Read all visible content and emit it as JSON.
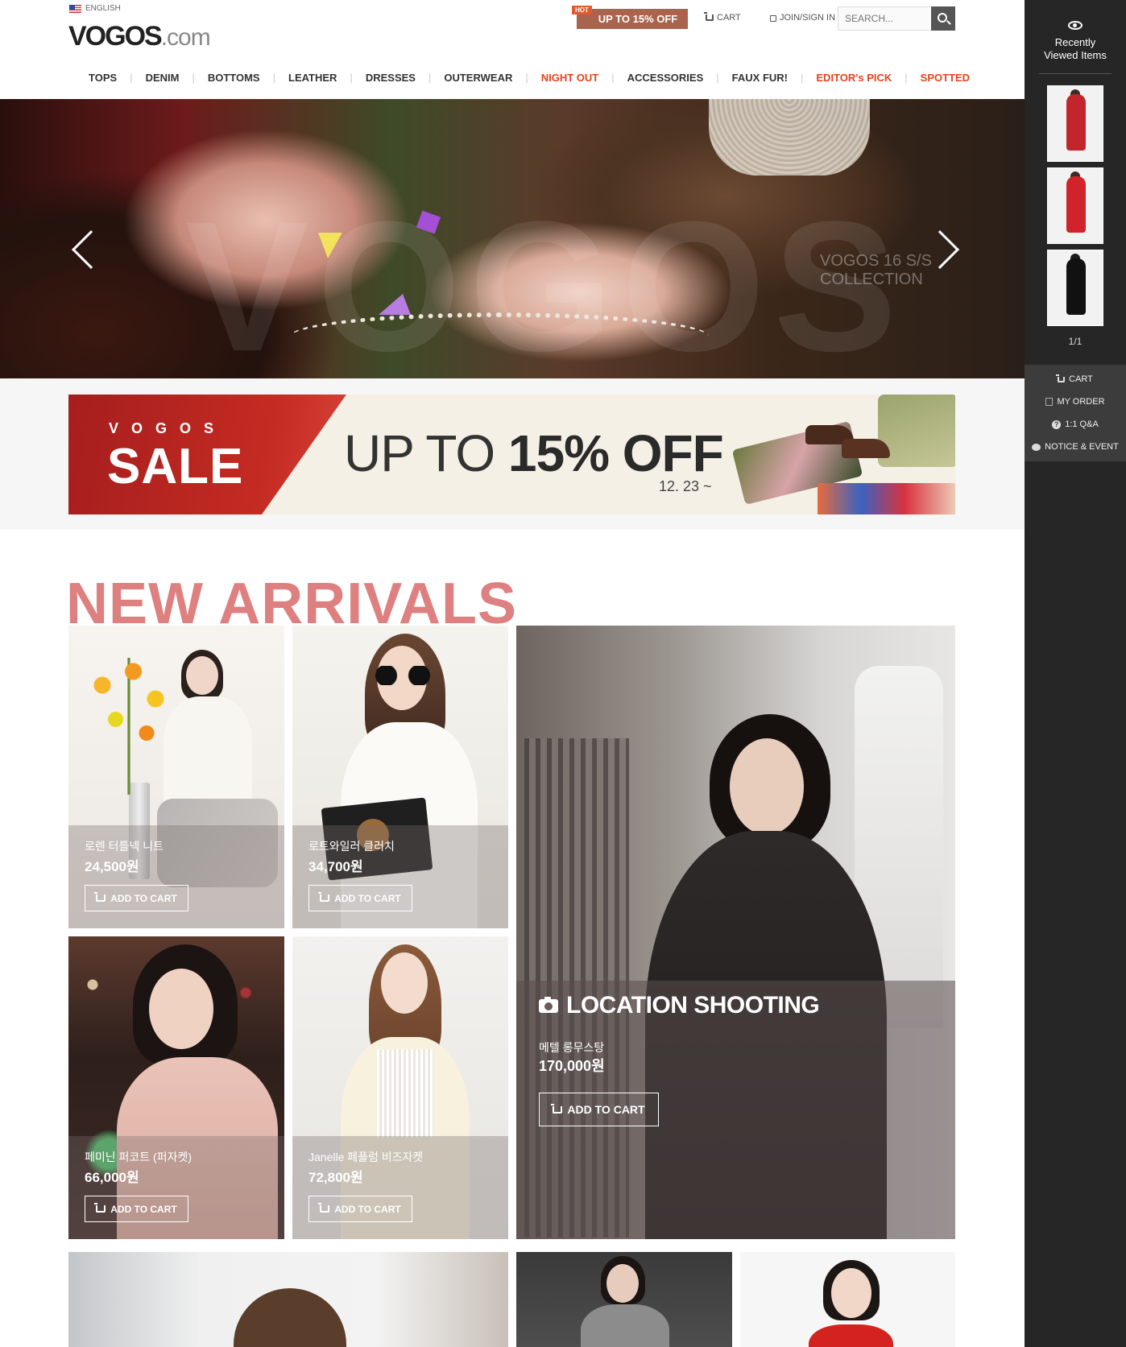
{
  "header": {
    "language": "ENGLISH",
    "logo_main": "VOGOS",
    "logo_suffix": ".com",
    "promo_badge": "HOT",
    "promo_text": "UP TO 15% OFF",
    "cart_link": "CART",
    "join_link": "JOIN/SIGN IN",
    "search_placeholder": "SEARCH..."
  },
  "nav": {
    "items": [
      {
        "label": "TOPS"
      },
      {
        "label": "DENIM"
      },
      {
        "label": "BOTTOMS"
      },
      {
        "label": "LEATHER"
      },
      {
        "label": "DRESSES"
      },
      {
        "label": "OUTERWEAR"
      },
      {
        "label": "NIGHT OUT"
      },
      {
        "label": "ACCESSORIES"
      },
      {
        "label": "FAUX FUR!"
      },
      {
        "label": "EDITOR's PICK"
      },
      {
        "label": "SPOTTED"
      }
    ],
    "highlight_color": "#e8421a"
  },
  "hero": {
    "overlay_text": "VOGOS 16 S/S COLLECTION"
  },
  "sale_banner": {
    "brand": "VOGOS",
    "sale": "SALE",
    "offer_prefix": "UP TO ",
    "offer_value": "15% OFF",
    "date": "12. 23 ~",
    "accent_color": "#b3231f"
  },
  "new_arrivals": {
    "title": "NEW ARRIVALS",
    "title_color": "#de8080",
    "add_to_cart": "ADD TO CART",
    "products": [
      {
        "name": "로렌 터틀넥 니트",
        "price": "24,500원"
      },
      {
        "name": "로트와일러 클러치",
        "price": "34,700원"
      },
      {
        "name": "페미닌 퍼코트 (퍼자켓)",
        "price": "66,000원"
      },
      {
        "name": "Janelle 페플럼 비즈자켓",
        "price": "72,800원"
      }
    ],
    "feature": {
      "title": "LOCATION SHOOTING",
      "name": "메텔 롱무스탕",
      "price": "170,000원"
    }
  },
  "sidebar": {
    "recent_title_line1": "Recently",
    "recent_title_line2": "Viewed Items",
    "page": "1/1",
    "menu": [
      {
        "label": "CART",
        "icon": "cart-icon"
      },
      {
        "label": "MY ORDER",
        "icon": "order-icon"
      },
      {
        "label": "1:1 Q&A",
        "icon": "question-icon"
      },
      {
        "label": "NOTICE & EVENT",
        "icon": "chat-icon"
      }
    ]
  }
}
